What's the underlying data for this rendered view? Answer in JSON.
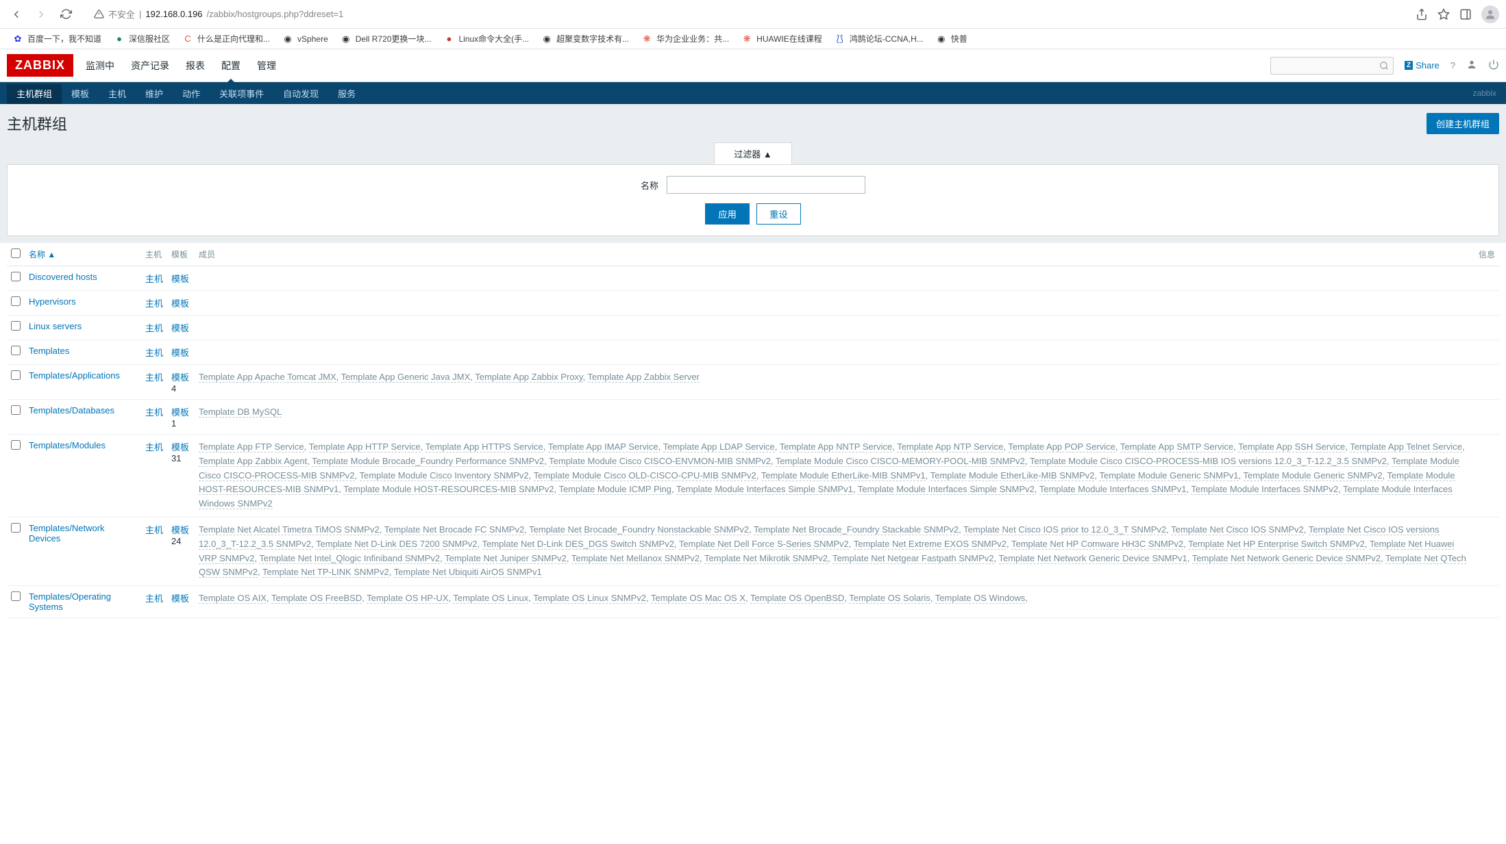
{
  "browser": {
    "url_insecure": "不安全",
    "url_host": "192.168.0.196",
    "url_path": "/zabbix/hostgroups.php?ddreset=1"
  },
  "bookmarks": [
    {
      "label": "百度一下，我不知道",
      "iconColor": "#2932e1",
      "glyph": "✿"
    },
    {
      "label": "深信服社区",
      "iconColor": "#1e824c",
      "glyph": "●"
    },
    {
      "label": "什么是正向代理和...",
      "iconColor": "#e74c3c",
      "glyph": "C"
    },
    {
      "label": "vSphere",
      "iconColor": "#333",
      "glyph": "◉"
    },
    {
      "label": "Dell R720更换一块...",
      "iconColor": "#333",
      "glyph": "◉"
    },
    {
      "label": "Linux命令大全(手...",
      "iconColor": "#c0392b",
      "glyph": "●"
    },
    {
      "label": "超聚变数字技术有...",
      "iconColor": "#333",
      "glyph": "◉"
    },
    {
      "label": "华为企业业务：共...",
      "iconColor": "#e74c3c",
      "glyph": "❋"
    },
    {
      "label": "HUAWIE在线课程",
      "iconColor": "#e74c3c",
      "glyph": "❋"
    },
    {
      "label": "鸿鹄论坛-CCNA,H...",
      "iconColor": "#1f5fbf",
      "glyph": "⟅⟆"
    },
    {
      "label": "快普",
      "iconColor": "#333",
      "glyph": "◉"
    }
  ],
  "mainNav": [
    "监测中",
    "资产记录",
    "报表",
    "配置",
    "管理"
  ],
  "mainNavActive": 3,
  "shareLabel": "Share",
  "subNav": [
    "主机群组",
    "模板",
    "主机",
    "维护",
    "动作",
    "关联项事件",
    "自动发现",
    "服务"
  ],
  "subNavActive": 0,
  "crumb": "zabbix",
  "pageTitle": "主机群组",
  "createBtn": "创建主机群组",
  "filter": {
    "tab": "过滤器 ▲",
    "nameLabel": "名称",
    "apply": "应用",
    "reset": "重设"
  },
  "columns": {
    "name": "名称 ▲",
    "hosts": "主机",
    "templates": "模板",
    "members": "成员",
    "info": "信息"
  },
  "labels": {
    "hostsLink": "主机",
    "tmplLink": "模板",
    "tmplPrefix": "模板"
  },
  "rows": [
    {
      "name": "Discovered hosts",
      "tmplCount": "",
      "members": []
    },
    {
      "name": "Hypervisors",
      "tmplCount": "",
      "members": []
    },
    {
      "name": "Linux servers",
      "tmplCount": "",
      "members": []
    },
    {
      "name": "Templates",
      "tmplCount": "",
      "members": []
    },
    {
      "name": "Templates/Applications",
      "tmplCount": " 4",
      "members": [
        "Template App Apache Tomcat JMX",
        "Template App Generic Java JMX",
        "Template App Zabbix Proxy",
        "Template App Zabbix Server"
      ]
    },
    {
      "name": "Templates/Databases",
      "tmplCount": " 1",
      "members": [
        "Template DB MySQL"
      ]
    },
    {
      "name": "Templates/Modules",
      "tmplCount": " 31",
      "members": [
        "Template App FTP Service",
        "Template App HTTP Service",
        "Template App HTTPS Service",
        "Template App IMAP Service",
        "Template App LDAP Service",
        "Template App NNTP Service",
        "Template App NTP Service",
        "Template App POP Service",
        "Template App SMTP Service",
        "Template App SSH Service",
        "Template App Telnet Service",
        "Template App Zabbix Agent",
        "Template Module Brocade_Foundry Performance SNMPv2",
        "Template Module Cisco CISCO-ENVMON-MIB SNMPv2",
        "Template Module Cisco CISCO-MEMORY-POOL-MIB SNMPv2",
        "Template Module Cisco CISCO-PROCESS-MIB IOS versions 12.0_3_T-12.2_3.5 SNMPv2",
        "Template Module Cisco CISCO-PROCESS-MIB SNMPv2",
        "Template Module Cisco Inventory SNMPv2",
        "Template Module Cisco OLD-CISCO-CPU-MIB SNMPv2",
        "Template Module EtherLike-MIB SNMPv1",
        "Template Module EtherLike-MIB SNMPv2",
        "Template Module Generic SNMPv1",
        "Template Module Generic SNMPv2",
        "Template Module HOST-RESOURCES-MIB SNMPv1",
        "Template Module HOST-RESOURCES-MIB SNMPv2",
        "Template Module ICMP Ping",
        "Template Module Interfaces Simple SNMPv1",
        "Template Module Interfaces Simple SNMPv2",
        "Template Module Interfaces SNMPv1",
        "Template Module Interfaces SNMPv2",
        "Template Module Interfaces Windows SNMPv2"
      ]
    },
    {
      "name": "Templates/Network Devices",
      "tmplCount": " 24",
      "members": [
        "Template Net Alcatel Timetra TiMOS SNMPv2",
        "Template Net Brocade FC SNMPv2",
        "Template Net Brocade_Foundry Nonstackable SNMPv2",
        "Template Net Brocade_Foundry Stackable SNMPv2",
        "Template Net Cisco IOS prior to 12.0_3_T SNMPv2",
        "Template Net Cisco IOS SNMPv2",
        "Template Net Cisco IOS versions 12.0_3_T-12.2_3.5 SNMPv2",
        "Template Net D-Link DES 7200 SNMPv2",
        "Template Net D-Link DES_DGS Switch SNMPv2",
        "Template Net Dell Force S-Series SNMPv2",
        "Template Net Extreme EXOS SNMPv2",
        "Template Net HP Comware HH3C SNMPv2",
        "Template Net HP Enterprise Switch SNMPv2",
        "Template Net Huawei VRP SNMPv2",
        "Template Net Intel_Qlogic Infiniband SNMPv2",
        "Template Net Juniper SNMPv2",
        "Template Net Mellanox SNMPv2",
        "Template Net Mikrotik SNMPv2",
        "Template Net Netgear Fastpath SNMPv2",
        "Template Net Network Generic Device SNMPv1",
        "Template Net Network Generic Device SNMPv2",
        "Template Net QTech QSW SNMPv2",
        "Template Net TP-LINK SNMPv2",
        "Template Net Ubiquiti AirOS SNMPv1"
      ]
    },
    {
      "name": "Templates/Operating Systems",
      "tmplCount": "",
      "members": [
        "Template OS AIX",
        "Template OS FreeBSD",
        "Template OS HP-UX",
        "Template OS Linux",
        "Template OS Linux SNMPv2",
        "Template OS Mac OS X",
        "Template OS OpenBSD",
        "Template OS Solaris",
        "Template OS Windows"
      ],
      "trailing": true
    }
  ]
}
